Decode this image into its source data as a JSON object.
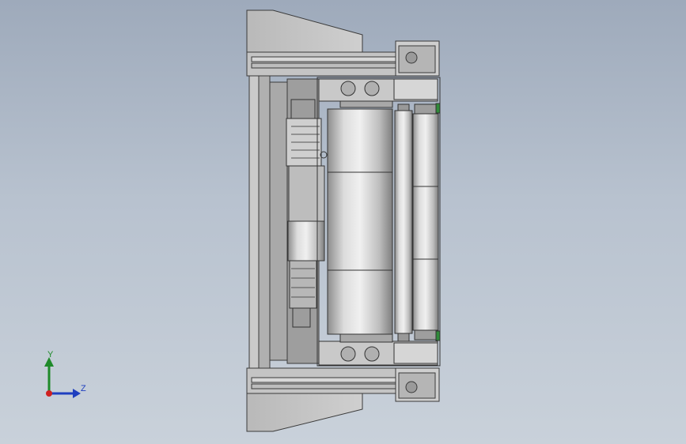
{
  "viewport": {
    "background_top": "#9eaabb",
    "background_bottom": "#c9d1da",
    "model_colors": {
      "steel": "#c8c8c8",
      "edge": "#3a3a3a",
      "accent": "#2f8a3a"
    }
  },
  "triad": {
    "y_label": "Y",
    "z_label": "Z",
    "colors": {
      "y": "#1f8a2a",
      "z": "#1f3fbf",
      "x": "#d02020"
    }
  }
}
